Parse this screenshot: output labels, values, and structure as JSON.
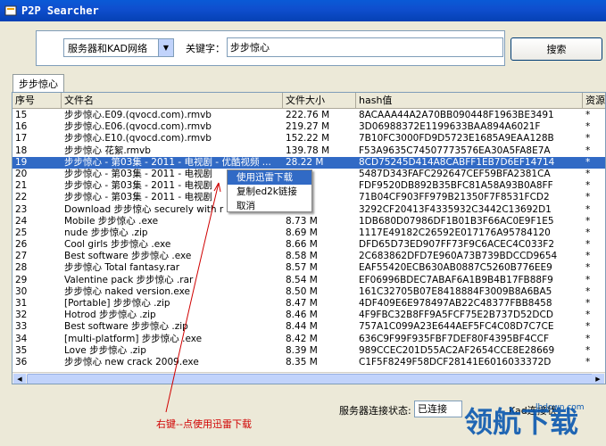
{
  "window": {
    "title": "P2P Searcher"
  },
  "search": {
    "network": "服务器和KAD网络",
    "keyword_label": "关键字：",
    "keyword": "步步惊心",
    "button": "搜索"
  },
  "tab": {
    "label": "步步惊心"
  },
  "columns": [
    "序号",
    "文件名",
    "文件大小",
    "hash值",
    "资源数"
  ],
  "rows": [
    [
      "15",
      "步步惊心.E09.(qvocd.com).rmvb",
      "222.76 M",
      "8ACAAA44A2A70BB090448F1963BE3491",
      "*"
    ],
    [
      "16",
      "步步惊心.E06.(qvocd.com).rmvb",
      "219.27 M",
      "3D06988372E1199633BAA894A6021F",
      "*"
    ],
    [
      "17",
      "步步惊心.E10.(qvocd.com).rmvb",
      "152.22 M",
      "7B10FC3000FD9D5723E1685A9EAA128B",
      "*"
    ],
    [
      "18",
      "步步惊心 花絮.rmvb",
      "139.78 M",
      "F53A9635C74507773576EA30A5FA8E7A",
      "*"
    ],
    [
      "19",
      "步步惊心 - 第03集 - 2011 - 电视剧 - 优酷视频 ...",
      "28.22 M",
      "8CD75245D414A8CABFF1EB7D6EF14714",
      "*"
    ],
    [
      "20",
      "步步惊心 - 第03集 - 2011 - 电视剧",
      "",
      "5487D343FAFC292647CEF59BFA2381CA",
      "*"
    ],
    [
      "21",
      "步步惊心 - 第03集 - 2011 - 电视剧",
      "",
      "FDF9520DB892B35BFC81A58A93B0A8FF",
      "*"
    ],
    [
      "22",
      "步步惊心 - 第03集 - 2011 - 电视剧",
      "",
      "71B04CF903FF979B21350F7F8531FCD2",
      "*"
    ],
    [
      "23",
      "Download 步步惊心 securely with r",
      "",
      "3292CF20413F4335932C3442C13692D1",
      "*"
    ],
    [
      "24",
      "Mobile 步步惊心 .exe",
      "8.73 M",
      "1DB680D07986DF1B01B3F66AC0E9F1E5",
      "*"
    ],
    [
      "25",
      "nude 步步惊心 .zip",
      "8.69 M",
      "1117E49182C26592E017176A95784120",
      "*"
    ],
    [
      "26",
      "Cool girls 步步惊心 .exe",
      "8.66 M",
      "DFD65D73ED907FF73F9C6ACEC4C033F2",
      "*"
    ],
    [
      "27",
      "Best software 步步惊心 .exe",
      "8.58 M",
      "2C683862DFD7E960A73B739BDCCD9654",
      "*"
    ],
    [
      "28",
      "步步惊心  Total fantasy.rar",
      "8.57 M",
      "EAF55420ECB630AB0887C5260B776EE9",
      "*"
    ],
    [
      "29",
      "Valentine pack 步步惊心 .rar",
      "8.54 M",
      "EF06996BDEC7ABAF6A1B9B4B17FB88F9",
      "*"
    ],
    [
      "30",
      "步步惊心  naked version.exe",
      "8.50 M",
      "161C32705B07E8418884F3009B8A6BA5",
      "*"
    ],
    [
      "31",
      "[Portable] 步步惊心 .zip",
      "8.47 M",
      "4DF409E6E978497AB22C48377FBB8458",
      "*"
    ],
    [
      "32",
      "Hotrod 步步惊心 .zip",
      "8.46 M",
      "4F9FBC32B8FF9A5FCF75E2B737D52DCD",
      "*"
    ],
    [
      "33",
      "Best software 步步惊心 .zip",
      "8.44 M",
      "757A1C099A23E644AEF5FC4C08D7C7CE",
      "*"
    ],
    [
      "34",
      "[multi-platform] 步步惊心 .exe",
      "8.42 M",
      "636C9F99F935FBF7DEF80F4395BF4CCF",
      "*"
    ],
    [
      "35",
      "Love 步步惊心 .zip",
      "8.39 M",
      "989CCEC201D55AC2AF2654CCE8E28669",
      "*"
    ],
    [
      "36",
      "步步惊心  new crack 2009.exe",
      "8.35 M",
      "C1F5F8249F58DCF28141E6016033372D",
      "*"
    ]
  ],
  "selected_row": 4,
  "context_menu": [
    "使用迅雷下载",
    "复制ed2k链接",
    "取消"
  ],
  "status": {
    "label": "服务器连接状态:",
    "value": "已连接",
    "kad_label": "Kad连接状"
  },
  "annotation": "右键--点使用迅雷下载",
  "watermark": {
    "text": "领航下载",
    "url": "lhdown.com"
  },
  "colors": {
    "title_bar": "#0a5ad6",
    "selection": "#316ac5",
    "annotation": "#d00000"
  }
}
